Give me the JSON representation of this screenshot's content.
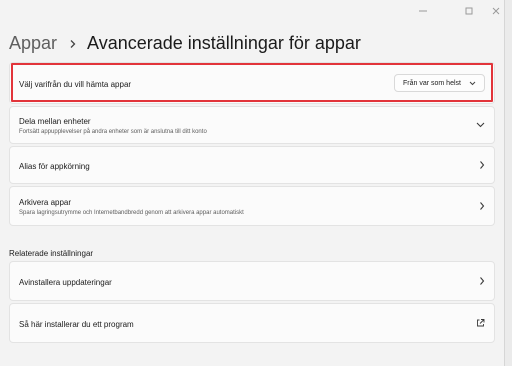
{
  "window": {
    "controls": {
      "minimize_icon": "minimize-icon",
      "maximize_icon": "maximize-icon",
      "close_icon": "close-icon"
    }
  },
  "breadcrumb": {
    "parent": "Appar",
    "separator_icon": "chevron-right-icon",
    "current": "Avancerade inställningar för appar"
  },
  "settings": [
    {
      "title": "Välj varifrån du vill hämta appar",
      "dropdown_value": "Från var som helst",
      "highlighted": true
    },
    {
      "title": "Dela mellan enheter",
      "description": "Fortsätt appupplevelser på andra enheter som är anslutna till ditt konto",
      "icon": "chevron-down-icon"
    },
    {
      "title": "Alias för appkörning",
      "icon": "chevron-right-icon"
    },
    {
      "title": "Arkivera appar",
      "description": "Spara lagringsutrymme och Internetbandbredd genom att arkivera appar automatiskt",
      "icon": "chevron-right-icon"
    }
  ],
  "related": {
    "heading": "Relaterade inställningar",
    "items": [
      {
        "title": "Avinstallera uppdateringar",
        "icon": "chevron-right-icon"
      },
      {
        "title": "Så här installerar du ett program",
        "icon": "external-link-icon"
      }
    ]
  },
  "colors": {
    "highlight": "#e2343a",
    "background": "#f3f3f3",
    "card": "#fbfbfb"
  }
}
